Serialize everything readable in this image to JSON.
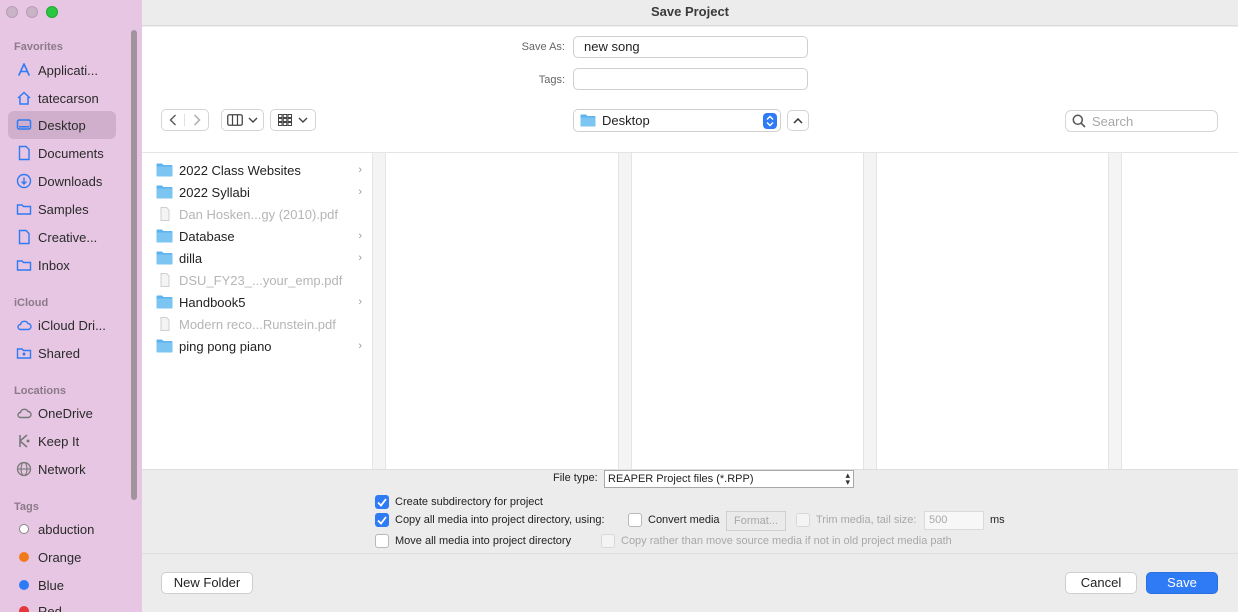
{
  "window": {
    "title": "Save Project"
  },
  "sidebar": {
    "sections": {
      "favorites": "Favorites",
      "icloud": "iCloud",
      "locations": "Locations",
      "tags": "Tags"
    },
    "favorites": [
      {
        "label": "Applicati...",
        "icon": "applications-icon"
      },
      {
        "label": "tatecarson",
        "icon": "home-icon"
      },
      {
        "label": "Desktop",
        "icon": "desktop-icon",
        "selected": true
      },
      {
        "label": "Documents",
        "icon": "document-icon"
      },
      {
        "label": "Downloads",
        "icon": "download-icon"
      },
      {
        "label": "Samples",
        "icon": "folder-icon"
      },
      {
        "label": "Creative...",
        "icon": "document-icon"
      },
      {
        "label": "Inbox",
        "icon": "folder-icon"
      }
    ],
    "icloud": [
      {
        "label": "iCloud Dri...",
        "icon": "cloud-icon"
      },
      {
        "label": "Shared",
        "icon": "shared-folder-icon"
      }
    ],
    "locations": [
      {
        "label": "OneDrive",
        "icon": "cloud-icon"
      },
      {
        "label": "Keep It",
        "icon": "keepit-icon"
      },
      {
        "label": "Network",
        "icon": "network-icon"
      }
    ],
    "tags": [
      {
        "label": "abduction",
        "color": "#ffffff"
      },
      {
        "label": "Orange",
        "color": "#f07b1a"
      },
      {
        "label": "Blue",
        "color": "#2f7bf5"
      },
      {
        "label": "Red",
        "color": "#e5383b"
      }
    ]
  },
  "form": {
    "save_as_label": "Save As:",
    "save_as_value": "new song",
    "tags_label": "Tags:",
    "tags_value": ""
  },
  "toolbar": {
    "location": "Desktop",
    "search_placeholder": "Search"
  },
  "files": [
    {
      "name": "2022 Class Websites",
      "type": "folder"
    },
    {
      "name": "2022 Syllabi",
      "type": "folder"
    },
    {
      "name": "Dan Hosken...gy (2010).pdf",
      "type": "pdf"
    },
    {
      "name": "Database",
      "type": "folder"
    },
    {
      "name": "dilla",
      "type": "folder"
    },
    {
      "name": "DSU_FY23_...your_emp.pdf",
      "type": "pdf"
    },
    {
      "name": "Handbook5",
      "type": "folder"
    },
    {
      "name": "Modern reco...Runstein.pdf",
      "type": "pdf"
    },
    {
      "name": "ping pong piano",
      "type": "folder"
    }
  ],
  "options": {
    "file_type_label": "File type:",
    "file_type_value": "REAPER Project files (*.RPP)",
    "create_subdir": {
      "label": "Create subdirectory for project",
      "checked": true
    },
    "copy_media": {
      "label": "Copy all media into project directory, using:",
      "checked": true
    },
    "convert_media": {
      "label": "Convert media",
      "checked": false
    },
    "format_button": "Format...",
    "trim_media": {
      "label": "Trim media, tail size:",
      "checked": false
    },
    "tail_size_value": "500",
    "tail_size_unit": "ms",
    "move_media": {
      "label": "Move all media into project directory",
      "checked": false
    },
    "copy_rather": {
      "label": "Copy rather than move source media if not in old project media path",
      "checked": false
    }
  },
  "footer": {
    "new_folder": "New Folder",
    "cancel": "Cancel",
    "save": "Save"
  },
  "colors": {
    "accent": "#2f7bf5",
    "sidebar_bg": "#e6c6e2",
    "folder": "#5eb3ec"
  }
}
